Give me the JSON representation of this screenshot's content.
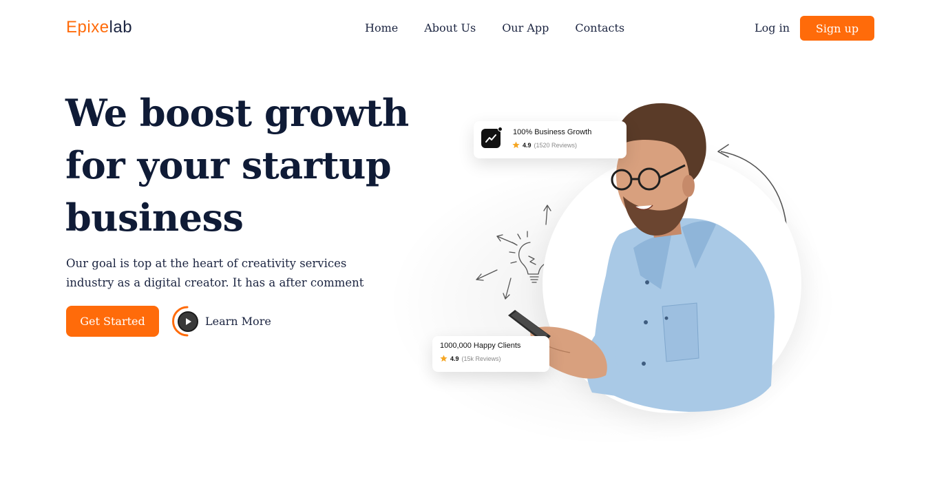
{
  "brand": {
    "logo_e": "E",
    "logo_p1": "pixe",
    "logo_p2": "lab",
    "accent": "#ff6b0a",
    "dark": "#0f1b36"
  },
  "nav": {
    "items": [
      {
        "label": "Home"
      },
      {
        "label": "About Us"
      },
      {
        "label": "Our App"
      },
      {
        "label": "Contacts"
      }
    ],
    "login_label": "Log in",
    "signup_label": "Sign up"
  },
  "hero": {
    "headline_line1": "We boost growth",
    "headline_line2": "for your startup",
    "headline_line3": "business",
    "subtext": "Our goal is top at the heart of creativity services industry as a digital creator. It has a after comment",
    "cta_primary": "Get Started",
    "cta_secondary": "Learn More"
  },
  "cards": {
    "growth": {
      "title": "100% Business Growth",
      "rating": "4.9",
      "reviews": "(1520 Reviews)",
      "icon": "trend-chart-icon"
    },
    "clients": {
      "title": "1000,000 Happy Clients",
      "rating": "4.9",
      "reviews": "(15k Reviews)"
    }
  }
}
